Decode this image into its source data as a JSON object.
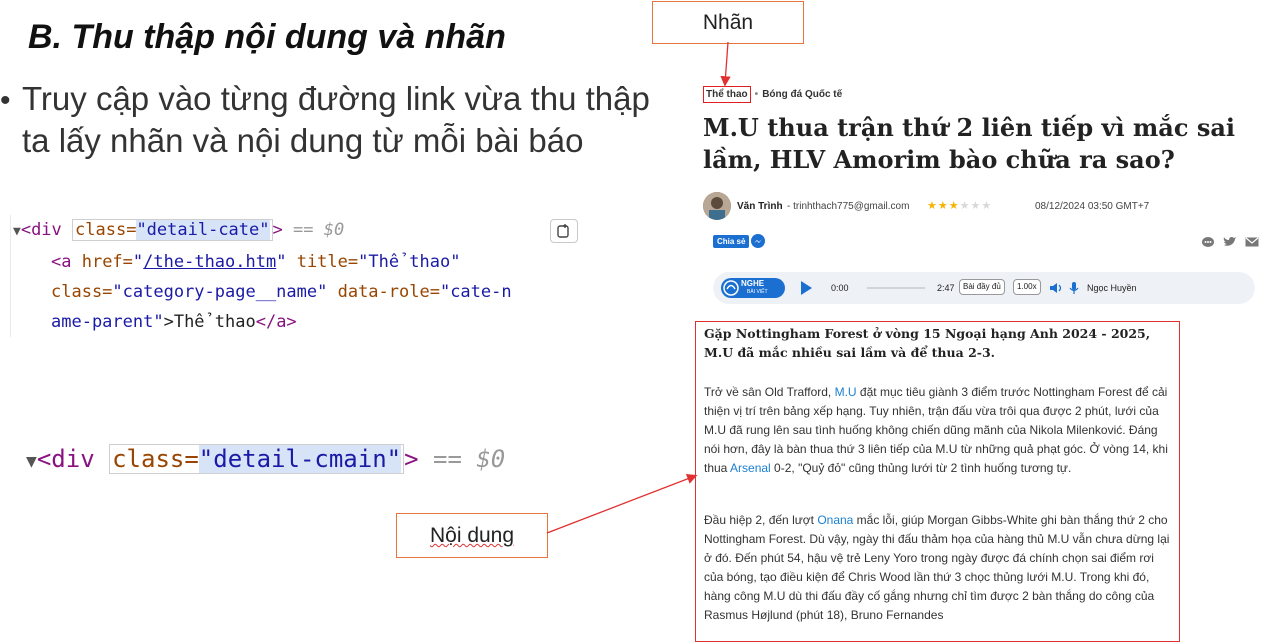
{
  "slide": {
    "heading": "B. Thu thập nội dung và nhãn",
    "bullet": "Truy cập vào từng đường link vừa thu thập ta lấy nhãn và nội dung từ mỗi bài báo"
  },
  "code_panel_1": {
    "line1_tag_open": "<div ",
    "line1_attr": "class=",
    "line1_value": "\"detail-cate\"",
    "line1_close": ">",
    "line1_sel": "== $0",
    "line2_a": "<a ",
    "line2_href": "href=",
    "line2_href_q1": "\"",
    "line2_href_val": "/the-thao.htm",
    "line2_href_q2": "\"",
    "line2_title": " title=",
    "line2_title_val": "\"Thể thao\"",
    "line3_class": "class=",
    "line3_class_val": "\"category-page__name\"",
    "line3_role": " data-role=",
    "line3_role_val": "\"cate-n",
    "line4_role_val": "ame-parent\"",
    "line4_text": ">Thể thao",
    "line4_close": "</a>"
  },
  "code_panel_2": {
    "tag_open": "<div ",
    "attr": "class=",
    "value": "\"detail-cmain\"",
    "close": ">",
    "sel": "== $0"
  },
  "callouts": {
    "label": "Nhãn",
    "content": "Nội dung"
  },
  "article": {
    "category": "Thể thao",
    "subcategory": "Bóng đá Quốc tế",
    "title": "M.U thua trận thứ 2 liên tiếp vì mắc sai lầm, HLV Amorim bào chữa ra sao?",
    "author": "Văn Trình",
    "email": "- trinhthach775@gmail.com",
    "rating": 3,
    "rating_max": 6,
    "date": "08/12/2024 03:50 GMT+7",
    "share_label": "Chia sẻ",
    "player": {
      "listen_label": "NGHE",
      "listen_sub": "BÀI VIẾT",
      "time_start": "0:00",
      "time_end": "2:47",
      "full_label": "Bài đầy đủ",
      "speed": "1.00x",
      "voice": "Ngọc Huyền"
    },
    "sapo": "Gặp Nottingham Forest ở vòng 15 Ngoại hạng Anh 2024 - 2025, M.U đã mắc nhiều sai lầm và để thua 2-3.",
    "p1_a": "Trở về sân Old Trafford, ",
    "p1_link": "M.U",
    "p1_b": " đặt mục tiêu giành 3 điểm trước Nottingham Forest để cải thiện vị trí trên bảng xếp hạng. Tuy nhiên, trận đấu vừa trôi qua được 2 phút, lưới của M.U đã rung lên sau tình huống không chiến dũng mãnh của Nikola Milenković. Đáng nói hơn, đây là bàn thua thứ 3 liên tiếp của M.U từ những quả phạt góc. Ở vòng 14, khi thua ",
    "p1_link2": "Arsenal",
    "p1_c": " 0-2, \"Quỷ đỏ\" cũng thủng lưới từ 2 tình huống tương tự.",
    "p2_a": "Đầu hiệp 2, đến lượt ",
    "p2_link": "Onana",
    "p2_b": " mắc lỗi, giúp Morgan Gibbs-White ghi bàn thắng thứ 2 cho Nottingham Forest. Dù vậy, ngày thi đấu thảm họa của hàng thủ M.U vẫn chưa dừng lại ở đó. Đến phút 54, hậu vệ trẻ Leny Yoro trong ngày được đá chính chọn sai điểm rơi của bóng, tạo điều kiện để Chris Wood lần thứ 3 chọc thủng lưới M.U. Trong khi đó, hàng công M.U dù thi đấu đầy cố gắng nhưng chỉ tìm được 2 bàn thắng do công của Rasmus Højlund (phút 18), Bruno Fernandes"
  },
  "colors": {
    "callout_border": "#e8763a",
    "highlight_box": "#e02020",
    "link_blue": "#1a7fd1"
  }
}
